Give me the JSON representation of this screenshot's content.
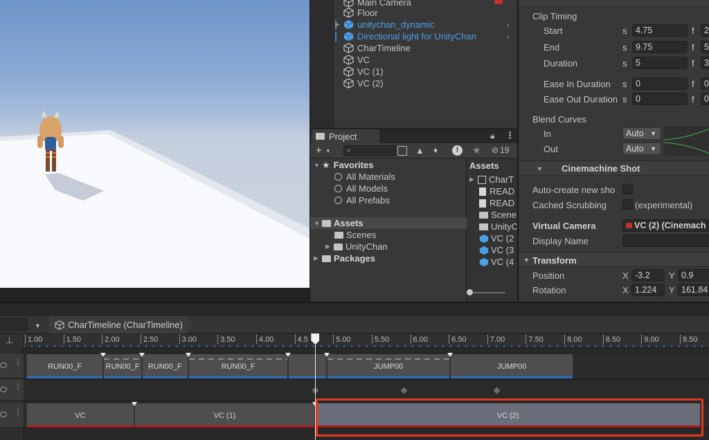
{
  "hierarchy": {
    "items": [
      {
        "label": "Main Camera",
        "type": "gameobject"
      },
      {
        "label": "Floor",
        "type": "gameobject"
      },
      {
        "label": "unitychan_dynamic",
        "type": "prefab"
      },
      {
        "label": "Directional light for UnityChan",
        "type": "prefab"
      },
      {
        "label": "CharTimeline",
        "type": "gameobject"
      },
      {
        "label": "VC",
        "type": "gameobject"
      },
      {
        "label": "VC (1)",
        "type": "gameobject"
      },
      {
        "label": "VC (2)",
        "type": "gameobject"
      }
    ]
  },
  "project": {
    "tab_label": "Project",
    "hidden_count": "19",
    "favorites": {
      "label": "Favorites",
      "items": [
        "All Materials",
        "All Models",
        "All Prefabs"
      ]
    },
    "assets": {
      "label": "Assets",
      "items": [
        "Scenes",
        "UnityChan"
      ]
    },
    "packages_label": "Packages",
    "assets_column_header": "Assets",
    "asset_files": [
      "CharT",
      "READ",
      "READ",
      "Scene",
      "UnityC",
      "VC (2",
      "VC (3",
      "VC (4"
    ]
  },
  "inspector": {
    "clip_timing": {
      "header": "Clip Timing",
      "start": {
        "label": "Start",
        "s": "4.75",
        "f": "2"
      },
      "end": {
        "label": "End",
        "s": "9.75",
        "f": "5"
      },
      "duration": {
        "label": "Duration",
        "s": "5",
        "f": "3"
      },
      "ease_in": {
        "label": "Ease In Duration",
        "s": "0",
        "f": "0"
      },
      "ease_out": {
        "label": "Ease Out Duration",
        "s": "0",
        "f": "0"
      },
      "unit_s": "s",
      "unit_f": "f"
    },
    "blend_curves": {
      "header": "Blend Curves",
      "in_label": "In",
      "in_value": "Auto",
      "out_label": "Out",
      "out_value": "Auto"
    },
    "cinemachine_shot": {
      "header": "Cinemachine Shot",
      "auto_create_label": "Auto-create new sho",
      "cached_scrubbing_label": "Cached Scrubbing",
      "experimental_label": "(experimental)",
      "virtual_camera_label": "Virtual Camera",
      "virtual_camera_value": "VC (2) (Cinemach",
      "display_name_label": "Display Name"
    },
    "transform": {
      "header": "Transform",
      "position_label": "Position",
      "position_x": "-3.2",
      "position_y": "0.9",
      "rotation_label": "Rotation",
      "rotation_x": "1.224",
      "rotation_y": "161.84",
      "axis_x": "X",
      "axis_y": "Y"
    }
  },
  "timeline": {
    "breadcrumb": "CharTimeline (CharTimeline)",
    "ruler_ticks": [
      "1.00",
      "1.50",
      "2.00",
      "2.50",
      "3.00",
      "3.50",
      "4.00",
      "4.5",
      "5.00",
      "5.50",
      "6.00",
      "6.50",
      "7.00",
      "7.50",
      "8.00",
      "8.50",
      "9.00",
      "9.50"
    ],
    "playhead_time": 4.75,
    "animation_clips": [
      {
        "label": "RUN00_F",
        "start": 1.0,
        "end": 2.0
      },
      {
        "label": "RUN00_F",
        "start": 2.0,
        "end": 2.5
      },
      {
        "label": "RUN00_F",
        "start": 2.5,
        "end": 3.1
      },
      {
        "label": "RUN00_F",
        "start": 3.1,
        "end": 4.4
      },
      {
        "label": "",
        "start": 4.4,
        "end": 4.9
      },
      {
        "label": "JUMP00",
        "start": 4.9,
        "end": 6.5
      },
      {
        "label": "JUMP00",
        "start": 6.5,
        "end": 8.1
      }
    ],
    "camera_clips": [
      {
        "label": "VC",
        "start": 1.0,
        "end": 2.4
      },
      {
        "label": "VC (1)",
        "start": 2.4,
        "end": 4.75
      },
      {
        "label": "VC (2)",
        "start": 4.75,
        "end": 9.75
      }
    ],
    "selected_clip": "VC (2)"
  },
  "colors": {
    "accent_blue": "#4b9fe6",
    "highlight_red": "#e8371f",
    "camera_track_underline": "#b3191c",
    "anim_track_underline": "#2f6fbf"
  }
}
